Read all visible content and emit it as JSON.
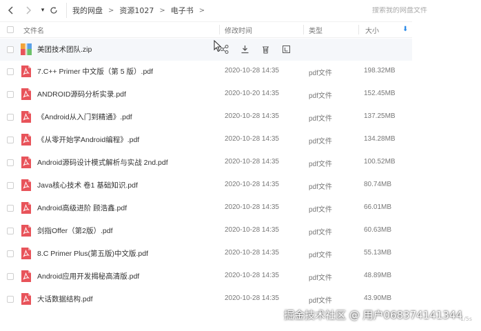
{
  "nav": {
    "back": "<",
    "forward": ">",
    "dropdown": "▾",
    "refresh": "⟳"
  },
  "breadcrumb": [
    {
      "label": "我的网盘"
    },
    {
      "label": "资源1027"
    },
    {
      "label": "电子书"
    }
  ],
  "search": {
    "placeholder": "搜索我的网盘文件"
  },
  "columns": {
    "name": "文件名",
    "modified": "修改时间",
    "type": "类型",
    "size": "大小"
  },
  "hover_row": {
    "name": "美团技术团队.zip",
    "icon": "zip-archive-icon",
    "actions": [
      "share-icon",
      "download-icon",
      "delete-icon",
      "more-icon"
    ]
  },
  "files": [
    {
      "name": "7.C++ Primer 中文版（第 5 版）.pdf",
      "modified": "2020-10-28 14:35",
      "type": "pdf文件",
      "size": "198.32MB"
    },
    {
      "name": "ANDROID源码分析实录.pdf",
      "modified": "2020-10-20 14:35",
      "type": "pdf文件",
      "size": "152.45MB"
    },
    {
      "name": "《Android从入门到精通》.pdf",
      "modified": "2020-10-28 14:35",
      "type": "pdf文件",
      "size": "137.25MB"
    },
    {
      "name": "《从零开始学Android编程》.pdf",
      "modified": "2020-10-28 14:35",
      "type": "pdf文件",
      "size": "134.28MB"
    },
    {
      "name": "Android源码设计模式解析与实战 2nd.pdf",
      "modified": "2020-10-28 14:35",
      "type": "pdf文件",
      "size": "100.52MB"
    },
    {
      "name": "Java核心技术 卷1 基础知识.pdf",
      "modified": "2020-10-28 14:35",
      "type": "pdf文件",
      "size": "80.74MB"
    },
    {
      "name": "Android高级进阶 顾浩鑫.pdf",
      "modified": "2020-10-28 14:35",
      "type": "pdf文件",
      "size": "66.01MB"
    },
    {
      "name": "剑指Offer（第2版）.pdf",
      "modified": "2020-10-28 14:35",
      "type": "pdf文件",
      "size": "60.63MB"
    },
    {
      "name": "8.C Primer Plus(第五版)中文版.pdf",
      "modified": "2020-10-28 14:35",
      "type": "pdf文件",
      "size": "55.13MB"
    },
    {
      "name": "Android应用开发揭秘高清版.pdf",
      "modified": "2020-10-28 14:35",
      "type": "pdf文件",
      "size": "48.89MB"
    },
    {
      "name": "大话数据结构.pdf",
      "modified": "2020-10-28 14:35",
      "type": "pdf文件",
      "size": "43.90MB"
    }
  ],
  "watermark": "掘金技术社区 @ 用户068374141344",
  "corner_tag": "1/5s",
  "colors": {
    "pdf_icon": "#e8535a",
    "sort_accent": "#2a8ae8"
  }
}
